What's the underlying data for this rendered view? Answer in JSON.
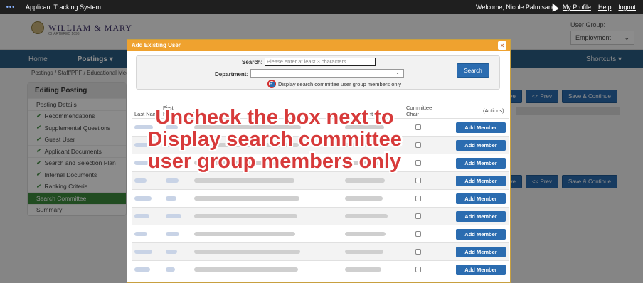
{
  "topbar": {
    "app_title": "Applicant Tracking System",
    "welcome": "Welcome, Nicole Palmisano",
    "links": [
      "My Profile",
      "Help",
      "logout"
    ]
  },
  "banner": {
    "logo_name": "WILLIAM & MARY",
    "logo_sub": "CHARTERED 1693",
    "user_group_label": "User Group:",
    "user_group_value": "Employment"
  },
  "nav": {
    "home": "Home",
    "postings": "Postings ▾",
    "shortcuts": "Shortcuts ▾"
  },
  "breadcrumb": "Postings / Staff/PPF / Educational Medi",
  "left_menu": {
    "heading": "Editing Posting",
    "items": [
      {
        "label": "Posting Details",
        "check": false,
        "active": false
      },
      {
        "label": "Recommendations",
        "check": true,
        "active": false
      },
      {
        "label": "Supplemental Questions",
        "check": true,
        "active": false
      },
      {
        "label": "Guest User",
        "check": true,
        "active": false
      },
      {
        "label": "Applicant Documents",
        "check": true,
        "active": false
      },
      {
        "label": "Search and Selection Plan",
        "check": true,
        "active": false
      },
      {
        "label": "Internal Documents",
        "check": true,
        "active": false
      },
      {
        "label": "Ranking Criteria",
        "check": true,
        "active": false
      },
      {
        "label": "Search Committee",
        "check": false,
        "active": true
      },
      {
        "label": "Summary",
        "check": false,
        "active": false
      }
    ]
  },
  "bg_buttons": {
    "save": "Save",
    "prev": "<< Prev",
    "save_continue": "Save & Continue"
  },
  "modal": {
    "title": "Add Existing User",
    "close": "×",
    "search_label": "Search:",
    "search_placeholder": "Please enter at least 3 characters",
    "department_label": "Department:",
    "department_arrow": "⌄",
    "checkbox_label": "Display search committee user group members only",
    "checkbox_checked": true,
    "search_button": "Search",
    "columns": {
      "last_name": "Last Name",
      "first_name_1": "First",
      "first_name_2": "Name",
      "email": "Email",
      "department": "Department",
      "chair_1": "Committee",
      "chair_2": "Chair",
      "actions": "(Actions)"
    },
    "add_member_label": "Add Member",
    "row_count": 9
  },
  "instruction": "Uncheck the box next to Display search committee user group members only",
  "colors": {
    "accent": "#2b6cb0",
    "modal_header": "#efa22f",
    "instruction": "#d73a3a",
    "active_menu": "#3c8a3c"
  }
}
